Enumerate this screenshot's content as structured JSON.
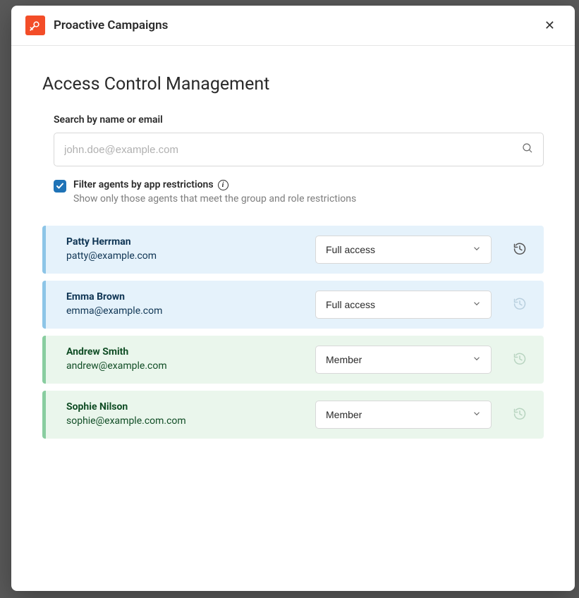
{
  "header": {
    "app_name": "Proactive Campaigns"
  },
  "page": {
    "title": "Access Control Management",
    "search": {
      "label": "Search by name or email",
      "placeholder": "john.doe@example.com"
    },
    "filter": {
      "checked": true,
      "label": "Filter agents by app restrictions",
      "description": "Show only those agents that meet the group and role restrictions"
    }
  },
  "users": [
    {
      "name": "Patty Herrman",
      "email": "patty@example.com",
      "role": "Full access",
      "variant": "blue",
      "history_active": true
    },
    {
      "name": "Emma Brown",
      "email": "emma@example.com",
      "role": "Full access",
      "variant": "blue",
      "history_active": false
    },
    {
      "name": "Andrew Smith",
      "email": "andrew@example.com",
      "role": "Member",
      "variant": "green",
      "history_active": false
    },
    {
      "name": "Sophie Nilson",
      "email": "sophie@example.com.com",
      "role": "Member",
      "variant": "green",
      "history_active": false
    }
  ]
}
